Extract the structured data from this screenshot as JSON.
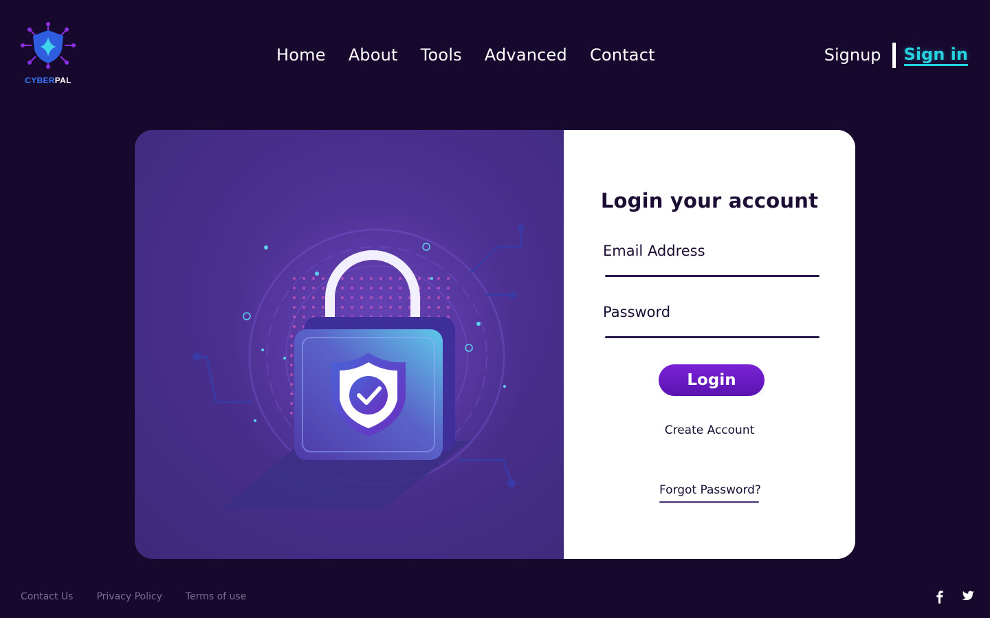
{
  "brand": {
    "name_part1": "CYBER",
    "name_part2": "PAL",
    "logo_icon": "shield-network-icon",
    "colors": {
      "primary": "#3a7bff",
      "accent": "#6a2bd9"
    }
  },
  "nav": {
    "items": [
      {
        "label": "Home"
      },
      {
        "label": "About"
      },
      {
        "label": "Tools"
      },
      {
        "label": "Advanced"
      },
      {
        "label": "Contact"
      }
    ]
  },
  "auth": {
    "signup_label": "Signup",
    "signin_label": "Sign in",
    "signin_color": "#25d3e0"
  },
  "illustration": {
    "icon": "padlock-shield-check-icon"
  },
  "login_form": {
    "title": "Login your account",
    "email_label": "Email Address",
    "email_value": "",
    "password_label": "Password",
    "password_value": "",
    "login_button": "Login",
    "create_account": "Create Account",
    "forgot_password": "Forgot Password?",
    "button_color": "#6a1bc4"
  },
  "footer": {
    "links": [
      "Contact Us",
      "Privacy Policy",
      "Terms of use"
    ],
    "social": [
      {
        "icon": "facebook-icon"
      },
      {
        "icon": "twitter-icon"
      }
    ]
  },
  "theme": {
    "background": "#17082e",
    "card_left": "#4a2f8e",
    "card_right": "#ffffff"
  }
}
